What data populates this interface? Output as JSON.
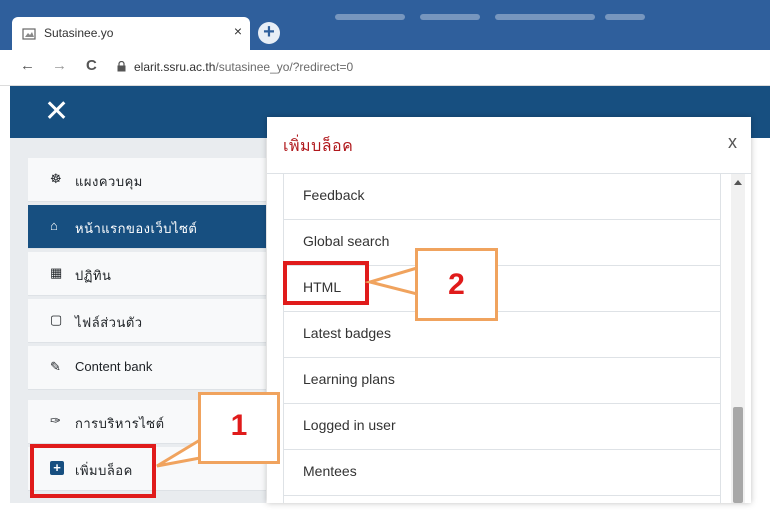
{
  "browser": {
    "tab_title": "Sutasinee.yo",
    "tab_close": "×",
    "new_tab": "+",
    "back": "←",
    "forward": "→",
    "reload": "C",
    "url_host": "elarit.ssru.ac.th",
    "url_path": "/sutasinee_yo/?redirect=0"
  },
  "navbar": {
    "close_glyph": "✕"
  },
  "sidebar": {
    "items": [
      {
        "label": "แผงควบคุม",
        "icon": "dashboard-icon",
        "glyph": "☸"
      },
      {
        "label": "หน้าแรกของเว็บไซต์",
        "icon": "home-icon",
        "glyph": "⌂"
      },
      {
        "label": "ปฏิทิน",
        "icon": "calendar-icon",
        "glyph": "▦"
      },
      {
        "label": "ไฟล์ส่วนตัว",
        "icon": "file-icon",
        "glyph": "▢"
      },
      {
        "label": "Content bank",
        "icon": "brush-icon",
        "glyph": "✎"
      },
      {
        "label": "การบริหารไซต์",
        "icon": "wrench-icon",
        "glyph": "✑"
      },
      {
        "label": "เพิ่มบล็อค",
        "icon": "plus-square-icon",
        "glyph": "+"
      }
    ]
  },
  "modal": {
    "title": "เพิ่มบล็อค",
    "close": "x",
    "blocks": [
      "Feedback",
      "Global search",
      "HTML",
      "Latest badges",
      "Learning plans",
      "Logged in user",
      "Mentees"
    ]
  },
  "annotations": {
    "callout_1": "1",
    "callout_2": "2"
  },
  "colors": {
    "navbar": "#174f80",
    "highlight": "#e01b1b",
    "callout_border": "#f0a35e",
    "modal_title": "#b0181c"
  }
}
